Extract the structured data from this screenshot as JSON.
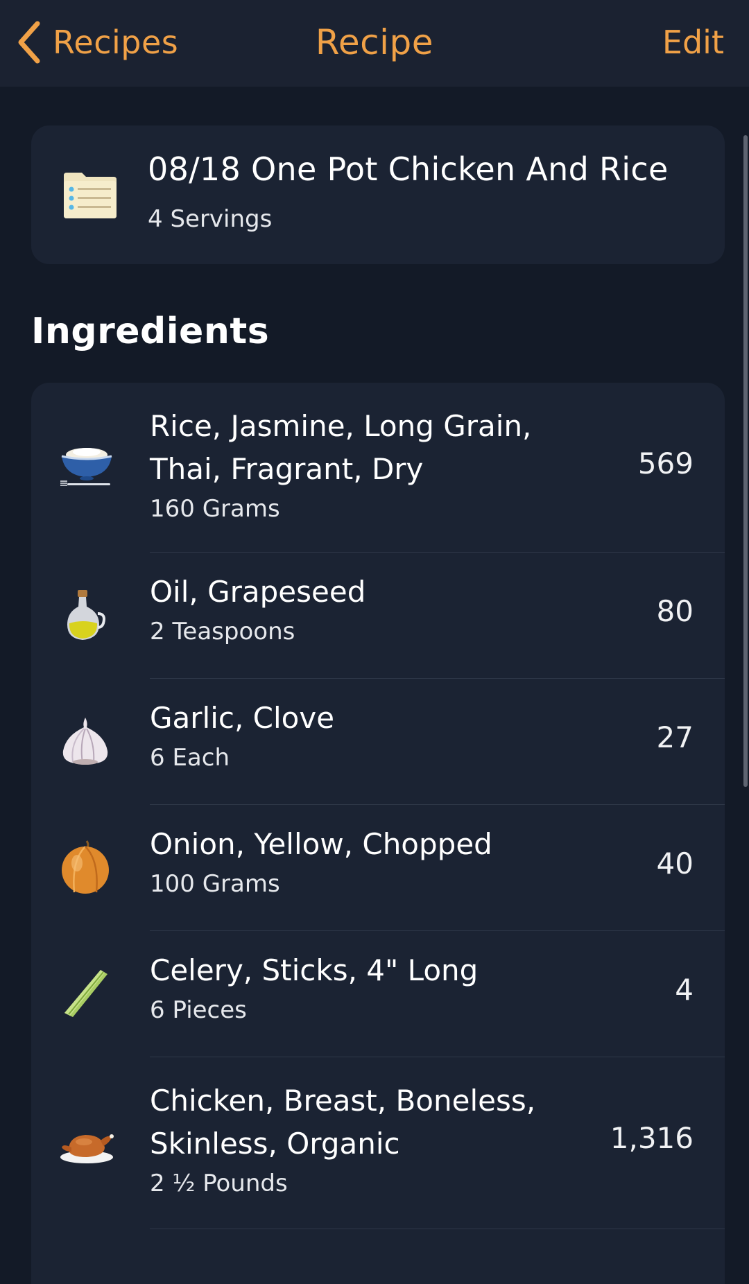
{
  "nav": {
    "back_label": "Recipes",
    "title": "Recipe",
    "edit_label": "Edit"
  },
  "recipe": {
    "name": "08/18 One Pot Chicken And Rice",
    "servings": "4 Servings",
    "icon": "recipe-card-icon"
  },
  "ingredients_heading": "Ingredients",
  "ingredients": [
    {
      "line1": "Rice, Jasmine, Long Grain,",
      "line2": "Thai, Fragrant, Dry",
      "amount": "160 Grams",
      "calories": "569",
      "icon": "rice-bowl-icon"
    },
    {
      "line1": "Oil, Grapeseed",
      "line2": "",
      "amount": "2 Teaspoons",
      "calories": "80",
      "icon": "oil-bottle-icon"
    },
    {
      "line1": "Garlic, Clove",
      "line2": "",
      "amount": "6 Each",
      "calories": "27",
      "icon": "garlic-icon"
    },
    {
      "line1": "Onion, Yellow, Chopped",
      "line2": "",
      "amount": "100 Grams",
      "calories": "40",
      "icon": "onion-icon"
    },
    {
      "line1": "Celery, Sticks, 4\" Long",
      "line2": "",
      "amount": "6 Pieces",
      "calories": "4",
      "icon": "celery-icon"
    },
    {
      "line1": "Chicken, Breast, Boneless,",
      "line2": "Skinless, Organic",
      "amount": "2 ½ Pounds",
      "calories": "1,316",
      "icon": "roast-chicken-icon"
    }
  ],
  "colors": {
    "accent": "#f0a147",
    "background": "#131a27",
    "card": "#1b2333",
    "navbar": "#1b2231"
  }
}
